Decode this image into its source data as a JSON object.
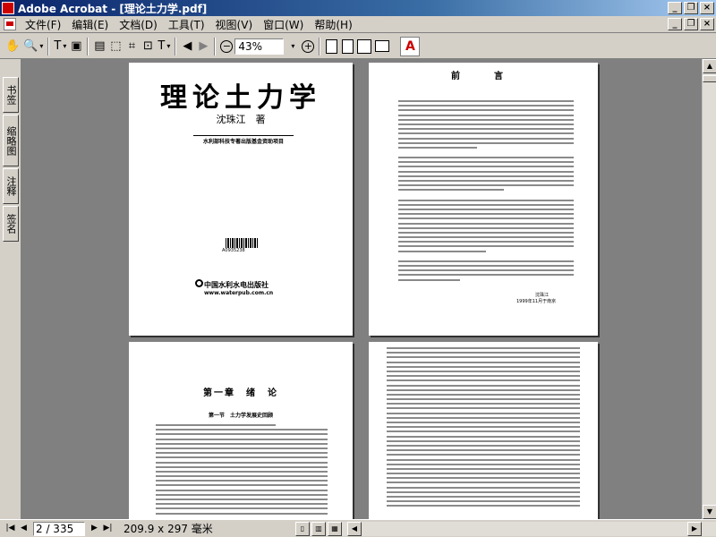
{
  "window": {
    "title": "Adobe Acrobat - [理论土力学.pdf]",
    "minimize": "_",
    "restore": "❐",
    "close": "×"
  },
  "menu": {
    "items": [
      "文件(F)",
      "编辑(E)",
      "文档(D)",
      "工具(T)",
      "视图(V)",
      "窗口(W)",
      "帮助(H)"
    ]
  },
  "toolbar": {
    "zoom_value": "43%",
    "zoom_out": "−",
    "zoom_in": "+"
  },
  "left_tabs": [
    "书签",
    "缩略图",
    "注释",
    "签名"
  ],
  "pages": {
    "cover": {
      "title": "理论土力学",
      "author": "沈珠江　著",
      "fund": "水利部科技专著出版基金资助项目",
      "barcode_number": "A0935238",
      "publisher": "中国水利水电出版社",
      "url": "www.waterpub.com.cn"
    },
    "preface": {
      "title": "前　言",
      "signature": "沈珠江",
      "date": "1999年11月于南京"
    },
    "chapter": {
      "title": "第一章　绪　论",
      "section": "第一节　土力学发展史回顾"
    }
  },
  "statusbar": {
    "page_field": "2 / 335",
    "page_size": "209.9 x 297 毫米"
  }
}
